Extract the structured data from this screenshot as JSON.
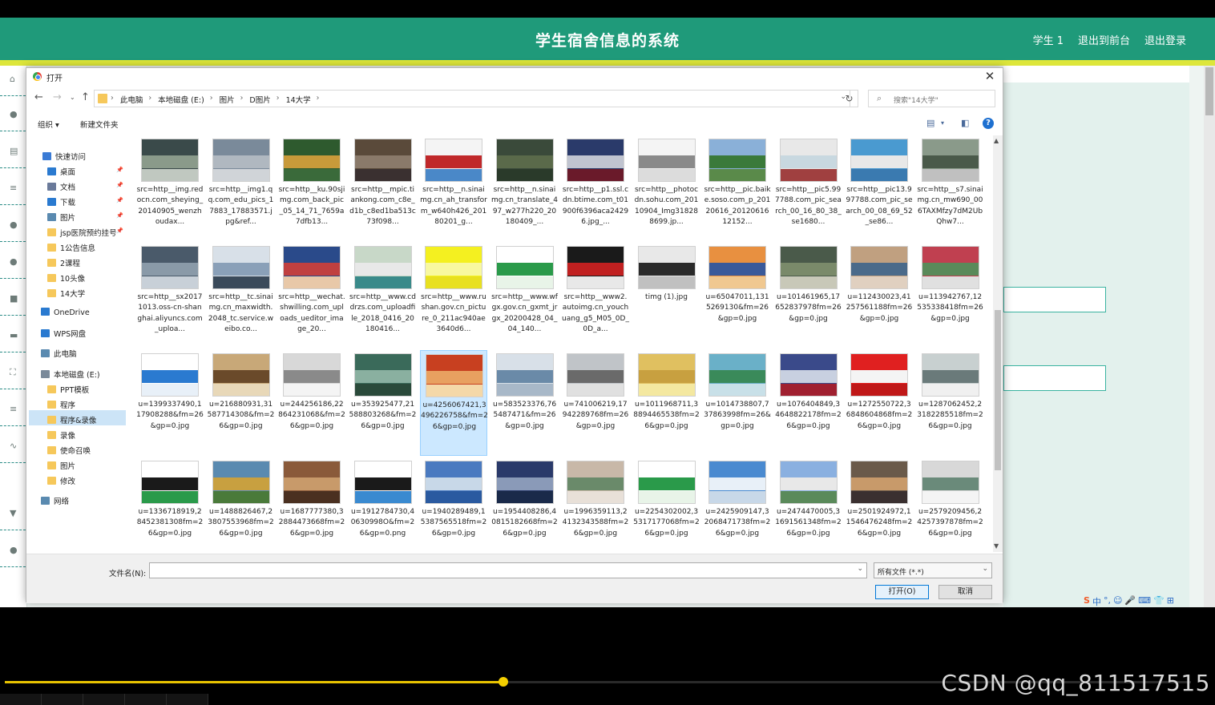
{
  "app": {
    "title": "学生宿舍信息的系统",
    "nav": [
      "学生 1",
      "退出到前台",
      "退出登录"
    ],
    "header_color": "#1f9a7a",
    "accent_color": "#dde63a"
  },
  "dialog": {
    "title": "打开",
    "breadcrumb": [
      "此电脑",
      "本地磁盘 (E:)",
      "图片",
      "D图片",
      "14大学"
    ],
    "search_placeholder": "搜索\"14大学\"",
    "toolbar": {
      "organize": "组织 ▾",
      "new_folder": "新建文件夹"
    },
    "tree": [
      {
        "label": "快速访问",
        "icon": "star-icon",
        "pinned": false
      },
      {
        "label": "桌面",
        "icon": "desktop-icon",
        "pinned": true
      },
      {
        "label": "文档",
        "icon": "document-icon",
        "pinned": true
      },
      {
        "label": "下载",
        "icon": "download-icon",
        "pinned": true
      },
      {
        "label": "图片",
        "icon": "pictures-icon",
        "pinned": true
      },
      {
        "label": "jsp医院预约挂号",
        "icon": "folder-icon",
        "pinned": true
      },
      {
        "label": "1公告信息",
        "icon": "folder-icon",
        "pinned": false
      },
      {
        "label": "2课程",
        "icon": "folder-icon",
        "pinned": false
      },
      {
        "label": "10头像",
        "icon": "folder-icon",
        "pinned": false
      },
      {
        "label": "14大学",
        "icon": "folder-icon",
        "pinned": false
      },
      {
        "label": "OneDrive",
        "icon": "cloud-icon",
        "pinned": false
      },
      {
        "label": "WPS网盘",
        "icon": "cloud-icon",
        "pinned": false
      },
      {
        "label": "此电脑",
        "icon": "computer-icon",
        "pinned": false
      },
      {
        "label": "本地磁盘 (E:)",
        "icon": "drive-icon",
        "pinned": false
      },
      {
        "label": "PPT模板",
        "icon": "folder-icon",
        "pinned": false
      },
      {
        "label": "程序",
        "icon": "folder-icon",
        "pinned": false
      },
      {
        "label": "程序&录像",
        "icon": "folder-icon",
        "pinned": false
      },
      {
        "label": "录像",
        "icon": "folder-icon",
        "pinned": false
      },
      {
        "label": "使命召唤",
        "icon": "folder-icon",
        "pinned": false
      },
      {
        "label": "图片",
        "icon": "folder-icon",
        "pinned": false
      },
      {
        "label": "修改",
        "icon": "folder-icon",
        "pinned": false
      },
      {
        "label": "网络",
        "icon": "network-icon",
        "pinned": false
      }
    ],
    "selected_tree_item": "此电脑",
    "files": [
      {
        "name": "src=http__img.redocn.com_sheying_20140905_wenzhoudax...",
        "colors": [
          "#3a4a4a",
          "#8a9a8a",
          "#c0c8c0"
        ]
      },
      {
        "name": "src=http__img1.qq.com_edu_pics_17883_17883571.jpg&ref...",
        "colors": [
          "#7a8a9a",
          "#b0b8c0",
          "#d0d4d8"
        ]
      },
      {
        "name": "src=http__ku.90sjimg.com_back_pic_05_14_71_7659a7dfb13...",
        "colors": [
          "#2e5a2e",
          "#c89a3a",
          "#3a6a3a"
        ]
      },
      {
        "name": "src=http__mpic.tiankong.com_c8e_d1b_c8ed1ba513c73f098...",
        "colors": [
          "#5a4a3a",
          "#8a7a6a",
          "#3a3030"
        ]
      },
      {
        "name": "src=http__n.sinaimg.cn_ah_transform_w640h426_20180201_g...",
        "colors": [
          "#f4f4f4",
          "#c0282a",
          "#4a88c8"
        ]
      },
      {
        "name": "src=http__n.sinaimg.cn_translate_497_w277h220_20180409_...",
        "colors": [
          "#3a4a3a",
          "#5a6a4a",
          "#2a3a2a"
        ]
      },
      {
        "name": "src=http__p1.ssl.cdn.btime.com_t01900f6396aca24296.jpg_...",
        "colors": [
          "#2a3a6a",
          "#c0c4d0",
          "#6a1a2a"
        ]
      },
      {
        "name": "src=http__photocdn.sohu.com_20110904_Img318288699.jp...",
        "colors": [
          "#f4f4f4",
          "#8a8a8a",
          "#dcdcdc"
        ]
      },
      {
        "name": "src=http__pic.baike.soso.com_p_20120616_2012061612152...",
        "colors": [
          "#8ab0d8",
          "#3a7a3a",
          "#5a8a4a"
        ]
      },
      {
        "name": "src=http__pic5.997788.com_pic_search_00_16_80_38_se1680...",
        "colors": [
          "#e8e8e8",
          "#c8d8e0",
          "#a04040"
        ]
      },
      {
        "name": "src=http__pic13.997788.com_pic_search_00_08_69_52_se86...",
        "colors": [
          "#4a9ad0",
          "#e8e8e8",
          "#3a7ab0"
        ]
      },
      {
        "name": "src=http__s7.sinaimg.cn_mw690_006TAXMfzy7dM2UbQhw7...",
        "colors": [
          "#8a9a8a",
          "#4a5a4a",
          "#c0c0c0"
        ]
      },
      {
        "name": "src=http__sx20171013.oss-cn-shanghai.aliyuncs.com_uploa...",
        "colors": [
          "#4a5a6a",
          "#8a9aa8",
          "#c8d0d8"
        ]
      },
      {
        "name": "src=http__tc.sinaimg.cn_maxwidth.2048_tc.service.weibo.co...",
        "colors": [
          "#d8e0e8",
          "#8aa0b8",
          "#3a4a5a"
        ]
      },
      {
        "name": "src=http__wechat.shwilling.com_uploads_ueditor_image_20...",
        "colors": [
          "#2a4a8a",
          "#c04040",
          "#e8c8a8"
        ]
      },
      {
        "name": "src=http__www.cddrzs.com_uploadfile_2018_0416_20180416...",
        "colors": [
          "#c8d8c8",
          "#e8e8e8",
          "#3a8a8a"
        ]
      },
      {
        "name": "src=http__www.rushan.gov.cn_picture_0_211ac940ae3640d6...",
        "colors": [
          "#f4f020",
          "#f8f8a0",
          "#e8e020"
        ]
      },
      {
        "name": "src=http__www.wfgx.gov.cn_gxmt_jrgx_20200428_04_04_140...",
        "colors": [
          "#ffffff",
          "#2a9a4a",
          "#e8f4e8"
        ]
      },
      {
        "name": "src=http__www2.autoimg.cn_youchuang_g5_M05_0D_0D_a...",
        "colors": [
          "#1a1a1a",
          "#c02020",
          "#e8e8e8"
        ]
      },
      {
        "name": "timg (1).jpg",
        "colors": [
          "#e8e8e8",
          "#2a2a2a",
          "#c0c0c0"
        ]
      },
      {
        "name": "u=65047011,1315269130&fm=26&gp=0.jpg",
        "colors": [
          "#e89040",
          "#3a5a9a",
          "#f0c890"
        ]
      },
      {
        "name": "u=101461965,17652837978fm=26&gp=0.jpg",
        "colors": [
          "#4a5a4a",
          "#7a8a6a",
          "#c8c8b8"
        ]
      },
      {
        "name": "u=112430023,41257561188fm=26&gp=0.jpg",
        "colors": [
          "#c0a080",
          "#4a6a8a",
          "#e0d0c0"
        ]
      },
      {
        "name": "u=113942767,12535338418fm=26&gp=0.jpg",
        "colors": [
          "#c04050",
          "#5a8a5a",
          "#e0e0e0"
        ]
      },
      {
        "name": "u=1399337490,117908288&fm=26&gp=0.jpg",
        "colors": [
          "#ffffff",
          "#2a7ad0",
          "#e8f0f8"
        ]
      },
      {
        "name": "u=216880931,31587714308&fm=26&gp=0.jpg",
        "colors": [
          "#c8a878",
          "#6a4a2a",
          "#e8d8b8"
        ]
      },
      {
        "name": "u=244256186,22864231068&fm=26&gp=0.jpg",
        "colors": [
          "#d8d8d8",
          "#8a8a8a",
          "#f4f4f4"
        ]
      },
      {
        "name": "u=353925477,21588803268&fm=26&gp=0.jpg",
        "colors": [
          "#3a6a5a",
          "#8ab0a0",
          "#2a4a3a"
        ]
      },
      {
        "name": "u=4256067421,3496226758&fm=26&gp=0.jpg",
        "colors": [
          "#c84020",
          "#e8a060",
          "#f4d8a8"
        ]
      },
      {
        "name": "u=583523376,765487471&fm=26&gp=0.jpg",
        "colors": [
          "#d8e0e8",
          "#6a8aa8",
          "#a8b8c8"
        ]
      },
      {
        "name": "u=741006219,17942289768fm=26&gp=0.jpg",
        "colors": [
          "#c0c4c8",
          "#6a6a6a",
          "#e0e0e0"
        ]
      },
      {
        "name": "u=1011968711,38894465538fm=26&gp=0.jpg",
        "colors": [
          "#e0c060",
          "#c8a040",
          "#f4e8a0"
        ]
      },
      {
        "name": "u=1014738807,737863998fm=26&gp=0.jpg",
        "colors": [
          "#6ab0c8",
          "#3a8a5a",
          "#c8e0e8"
        ]
      },
      {
        "name": "u=1076404849,34648822178fm=26&gp=0.jpg",
        "colors": [
          "#3a4a8a",
          "#c8d0e0",
          "#a02030"
        ]
      },
      {
        "name": "u=1272550722,36848604868fm=26&gp=0.jpg",
        "colors": [
          "#e02020",
          "#f4f4f4",
          "#c01818"
        ]
      },
      {
        "name": "u=1287062452,23182285518fm=26&gp=0.jpg",
        "colors": [
          "#c8d0d0",
          "#6a7a7a",
          "#f0f0f0"
        ]
      },
      {
        "name": "u=1336718919,28452381308fm=26&gp=0.jpg",
        "colors": [
          "#ffffff",
          "#1a1a1a",
          "#2a9a4a"
        ]
      },
      {
        "name": "u=1488826467,23807553968fm=26&gp=0.jpg",
        "colors": [
          "#5a8ab0",
          "#c8a040",
          "#4a7a3a"
        ]
      },
      {
        "name": "u=1687777380,32884473668fm=26&gp=0.jpg",
        "colors": [
          "#8a5a3a",
          "#c89a6a",
          "#4a3020"
        ]
      },
      {
        "name": "u=1912784730,40630998O&fm=26&gp=0.png",
        "colors": [
          "#ffffff",
          "#1a1a1a",
          "#3a8ad0"
        ]
      },
      {
        "name": "u=1940289489,15387565518fm=26&gp=0.jpg",
        "colors": [
          "#4a7ac0",
          "#c8d8e8",
          "#2a5aa0"
        ]
      },
      {
        "name": "u=1954408286,40815182668fm=26&gp=0.jpg",
        "colors": [
          "#2a3a6a",
          "#8a9ab8",
          "#1a2a4a"
        ]
      },
      {
        "name": "u=1996359113,24132343588fm=26&gp=0.jpg",
        "colors": [
          "#c8b8a8",
          "#6a8a6a",
          "#e8e0d8"
        ]
      },
      {
        "name": "u=2254302002,35317177068fm=26&gp=0.jpg",
        "colors": [
          "#ffffff",
          "#2a9a4a",
          "#e8f4e8"
        ]
      },
      {
        "name": "u=2425909147,32068471738fm=26&gp=0.jpg",
        "colors": [
          "#4a8ad0",
          "#e8f0f8",
          "#c8d8e8"
        ]
      },
      {
        "name": "u=2474470005,31691561348fm=26&gp=0.jpg",
        "colors": [
          "#8ab0e0",
          "#e8e8e8",
          "#5a8a5a"
        ]
      },
      {
        "name": "u=2501924972,11546476248fm=26&gp=0.jpg",
        "colors": [
          "#6a5a4a",
          "#c89a6a",
          "#3a3030"
        ]
      },
      {
        "name": "u=2579209456,24257397878fm=26&gp=0.jpg",
        "colors": [
          "#d8d8d8",
          "#6a8a7a",
          "#f4f4f4"
        ]
      }
    ],
    "selected_file_index": 28,
    "file_name_label": "文件名(N):",
    "file_name_value": "",
    "file_type": "所有文件 (*.*)",
    "open_button": "打开(O)",
    "cancel_button": "取消"
  },
  "ime": [
    "S",
    "中",
    "°,",
    "☺",
    "🎤",
    "⌨",
    "👕",
    "⊞"
  ],
  "player": {
    "progress": 0.42,
    "progress_color": "#e8c300"
  },
  "watermark": "CSDN @qq_811517515"
}
